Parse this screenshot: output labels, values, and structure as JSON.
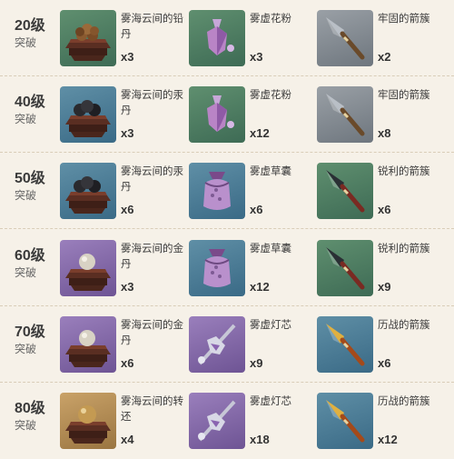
{
  "rows": [
    {
      "level": "20级",
      "stage": "突破",
      "items": [
        {
          "name": "雾海云间的铅丹",
          "qty": "x3",
          "icon": "lead-pill-icon",
          "bg": "green"
        },
        {
          "name": "雾虚花粉",
          "qty": "x3",
          "icon": "mist-pollen-icon",
          "bg": "green"
        },
        {
          "name": "牢固的箭簇",
          "qty": "x2",
          "icon": "firm-arrowhead-icon",
          "bg": "grey"
        }
      ]
    },
    {
      "level": "40级",
      "stage": "突破",
      "items": [
        {
          "name": "雾海云间的汞丹",
          "qty": "x3",
          "icon": "mercury-pill-icon",
          "bg": "blue"
        },
        {
          "name": "雾虚花粉",
          "qty": "x12",
          "icon": "mist-pollen-icon",
          "bg": "green"
        },
        {
          "name": "牢固的箭簇",
          "qty": "x8",
          "icon": "firm-arrowhead-icon",
          "bg": "grey"
        }
      ]
    },
    {
      "level": "50级",
      "stage": "突破",
      "items": [
        {
          "name": "雾海云间的汞丹",
          "qty": "x6",
          "icon": "mercury-pill-icon",
          "bg": "blue"
        },
        {
          "name": "雾虚草囊",
          "qty": "x6",
          "icon": "mist-grass-pouch-icon",
          "bg": "blue"
        },
        {
          "name": "锐利的箭簇",
          "qty": "x6",
          "icon": "sharp-arrowhead-icon",
          "bg": "green"
        }
      ]
    },
    {
      "level": "60级",
      "stage": "突破",
      "items": [
        {
          "name": "雾海云间的金丹",
          "qty": "x3",
          "icon": "golden-pill-icon",
          "bg": "purple"
        },
        {
          "name": "雾虚草囊",
          "qty": "x12",
          "icon": "mist-grass-pouch-icon",
          "bg": "blue"
        },
        {
          "name": "锐利的箭簇",
          "qty": "x9",
          "icon": "sharp-arrowhead-icon",
          "bg": "green"
        }
      ]
    },
    {
      "level": "70级",
      "stage": "突破",
      "items": [
        {
          "name": "雾海云间的金丹",
          "qty": "x6",
          "icon": "golden-pill-icon",
          "bg": "purple"
        },
        {
          "name": "雾虚灯芯",
          "qty": "x9",
          "icon": "mist-lamp-wick-icon",
          "bg": "purple"
        },
        {
          "name": "历战的箭簇",
          "qty": "x6",
          "icon": "weathered-arrowhead-icon",
          "bg": "blue"
        }
      ]
    },
    {
      "level": "80级",
      "stage": "突破",
      "items": [
        {
          "name": "雾海云间的转还",
          "qty": "x4",
          "icon": "reincarnation-pill-icon",
          "bg": "gold"
        },
        {
          "name": "雾虚灯芯",
          "qty": "x18",
          "icon": "mist-lamp-wick-icon",
          "bg": "purple"
        },
        {
          "name": "历战的箭簇",
          "qty": "x12",
          "icon": "weathered-arrowhead-icon",
          "bg": "blue"
        }
      ]
    }
  ]
}
